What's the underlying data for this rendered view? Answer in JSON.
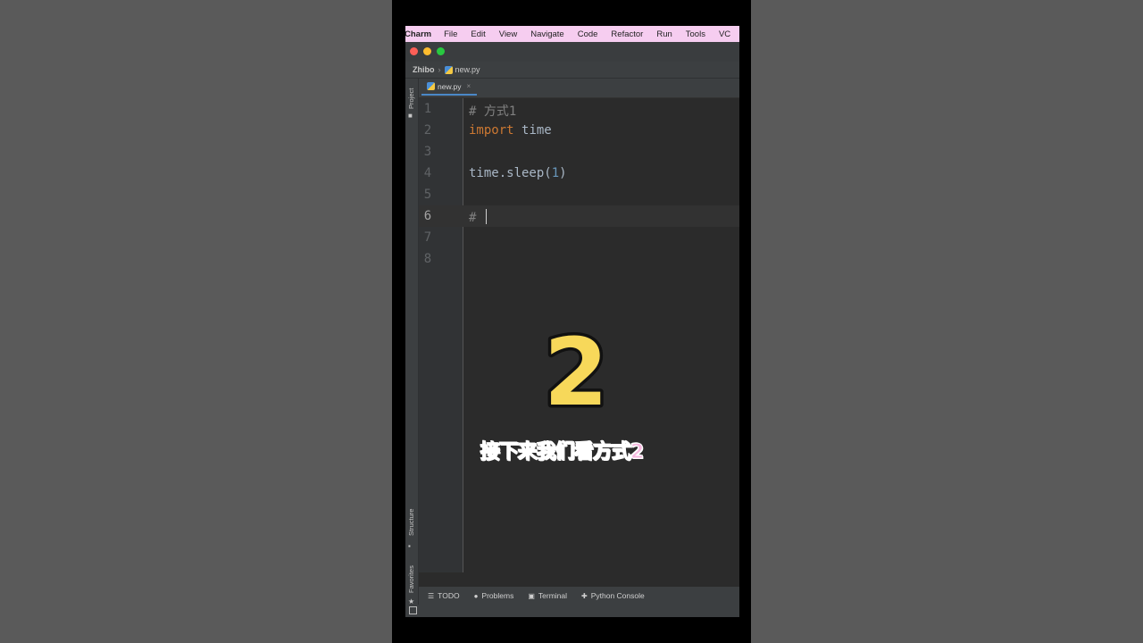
{
  "menubar": {
    "app": "Charm",
    "items": [
      "File",
      "Edit",
      "View",
      "Navigate",
      "Code",
      "Refactor",
      "Run",
      "Tools",
      "VC"
    ]
  },
  "breadcrumb": {
    "project": "Zhibo",
    "file": "new.py"
  },
  "tab": {
    "label": "new.py",
    "close": "×"
  },
  "side_labels": {
    "project": "Project",
    "structure": "Structure",
    "favorites": "Favorites"
  },
  "editor": {
    "line_numbers": [
      "1",
      "2",
      "3",
      "4",
      "5",
      "6",
      "7",
      "8"
    ],
    "line1": {
      "hash": "#",
      "text": "方式1"
    },
    "line2": {
      "keyword": "import",
      "module": "time"
    },
    "line4": {
      "prefix": "time.sleep(",
      "number": "1",
      "suffix": ")"
    },
    "line6": {
      "hash": "#"
    }
  },
  "status_tools": [
    {
      "icon": "☰",
      "label": "TODO"
    },
    {
      "icon": "●",
      "label": "Problems"
    },
    {
      "icon": "▣",
      "label": "Terminal"
    },
    {
      "icon": "✚",
      "label": "Python Console"
    }
  ],
  "overlay": {
    "number": "2",
    "subtitle": "接下来我们看方式2"
  },
  "colors": {
    "menubar": "#f6cdf0",
    "editor_bg": "#2b2b2b",
    "keyword": "#cc7832",
    "number": "#6897bb",
    "comment": "#808080",
    "subtitle": "#f7b8df",
    "big_number": "#f7d85a"
  }
}
